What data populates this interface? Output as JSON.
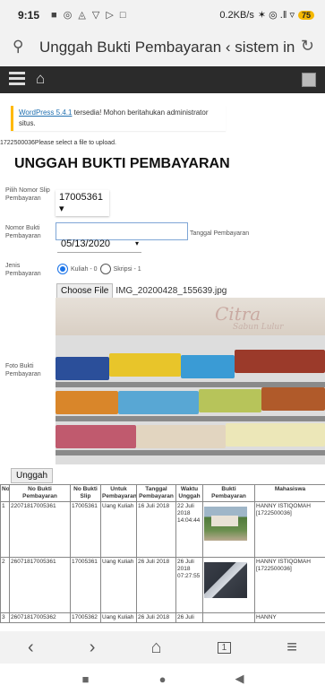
{
  "status_bar": {
    "time": "9:15",
    "left_icons": "■ ◎ ◬ ▽ ▷ □",
    "speed": "0.2KB/s",
    "right_icons": "✶ ◎ .‖ ▿",
    "battery": "75"
  },
  "url_bar": {
    "title": "Unggah Bukti Pembayaran ‹ sistem infor..."
  },
  "notice": {
    "link": "WordPress 5.4.1",
    "text": " tersedia! Mohon beritahukan administrator situs."
  },
  "upload_message": "1722500036Please select a file to upload.",
  "page_title": "UNGGAH BUKTI PEMBAYARAN",
  "form": {
    "slip_label": "Pilih Nomor Slip Pembayaran",
    "slip_value": "17005361",
    "bukti_label": "Nomor Bukti Pembayaran",
    "tanggal_label": "Tanggal Pembayaran",
    "date_value": "05/13/2020",
    "jenis_label": "Jenis Pembayaran",
    "radio_1": "Kuliah - 0",
    "radio_2": "Skripsi - 1",
    "choose_file": "Choose File",
    "file_name": "IMG_20200428_155639.jpg",
    "photo_label": "Foto Bukti Pembayaran",
    "photo_sign": "Citra",
    "photo_sign_sub": "Sabun Lulur",
    "upload_button": "Unggah"
  },
  "table": {
    "headers": [
      "No",
      "No Bukti Pembayaran",
      "No Bukti Slip",
      "Untuk Pembayaran",
      "Tanggal Pembayaran",
      "Waktu Unggah",
      "Bukti Pembayaran",
      "Mahasiswa"
    ],
    "rows": [
      {
        "no": "1",
        "bukti": "22071817005361",
        "slip": "17005361",
        "untuk": "Uang Kuliah",
        "tanggal": "16 Juli 2018",
        "waktu": "22 Juli 2018 14:04:44",
        "mahasiswa": "HANNY ISTIQOMAH [1722500036]"
      },
      {
        "no": "2",
        "bukti": "26071817005361",
        "slip": "17005361",
        "untuk": "Uang Kuliah",
        "tanggal": "26 Juli 2018",
        "waktu": "26 Juli 2018 07:27:55",
        "mahasiswa": "HANNY ISTIQOMAH [1722500036]"
      },
      {
        "no": "3",
        "bukti": "26071817005362",
        "slip": "17005362",
        "untuk": "Uang Kuliah",
        "tanggal": "26 Juli 2018",
        "waktu": "26 Juli",
        "mahasiswa": "HANNY"
      }
    ]
  },
  "nav": {
    "back": "‹",
    "forward": "›",
    "home": "⌂",
    "tabs": "1",
    "menu": "≡"
  },
  "system": {
    "recent": "■",
    "home": "●",
    "back": "◀"
  }
}
